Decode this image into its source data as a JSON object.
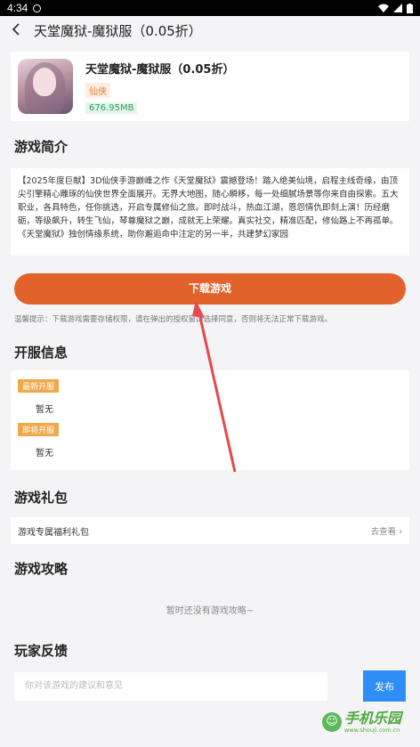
{
  "status": {
    "time": "4:34"
  },
  "nav": {
    "back_icon": "chevron-left-icon",
    "title": "天堂魔狱-魔狱服（0.05折）"
  },
  "app": {
    "name": "天堂魔狱-魔狱服（0.05折）",
    "category": "仙侠",
    "size": "676.95MB"
  },
  "intro": {
    "title": "游戏简介",
    "text": "【2025年度巨献】3D仙侠手游巅峰之作《天堂魔狱》震撼登场！踏入绝美仙境，启程主线奇缘，由顶尖引擎精心雕琢的仙侠世界全面展开。无界大地图，随心瞬移，每一处细腻场景等你来自由探索。五大职业，各具特色，任你挑选，开启专属修仙之旅。即时战斗，热血江湖，恩怨情仇即刻上演！历经磨砺，等级飙升，转生飞仙，琴尊魔狱之巅，成就无上荣耀。真实社交，精准匹配，修仙路上不再孤单。《天堂魔狱》独创情缘系统，助你邂逅命中注定的另一半，共建梦幻家园"
  },
  "download": {
    "label": "下载游戏",
    "tip": "温馨提示：下载游戏需要存储权限，请在弹出的授权窗口选择同意，否则将无法正常下载游戏。"
  },
  "server": {
    "title": "开服信息",
    "latest_label": "最新开服",
    "latest_value": "暂无",
    "upcoming_label": "即将开服",
    "upcoming_value": "暂无"
  },
  "gift": {
    "title": "游戏礼包",
    "row_label": "游戏专属福利礼包",
    "link_label": "去查看"
  },
  "guide": {
    "title": "游戏攻略",
    "empty": "暂时还没有游戏攻略~"
  },
  "feedback": {
    "title": "玩家反馈",
    "placeholder": "你对该游戏的建议和意见",
    "submit_label": "发布"
  },
  "watermark": {
    "name": "手机乐园",
    "url": "www.shouji.com.cn"
  },
  "colors": {
    "accent": "#e2622b",
    "primary_button": "#2f8ef5",
    "badge": "#f0a94a"
  }
}
